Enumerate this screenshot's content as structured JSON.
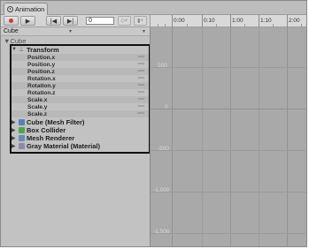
{
  "window": {
    "tab_title": "Animation"
  },
  "toolbar": {
    "frame_value": "0"
  },
  "ruler": {
    "labels": [
      "0:00",
      "0:10",
      "1:00",
      "1:10",
      "2:00"
    ]
  },
  "object_row": {
    "selected_object": "Cube"
  },
  "hierarchy": {
    "root": "Cube",
    "transform_label": "Transform",
    "properties": [
      "Position.x",
      "Position.y",
      "Position.z",
      "Rotation.x",
      "Rotation.y",
      "Rotation.z",
      "Scale.x",
      "Scale.y",
      "Scale.z"
    ],
    "components": [
      {
        "label": "Cube (Mesh Filter)",
        "icon": "mesh-filter-icon",
        "color": "#5a7fb8"
      },
      {
        "label": "Box Collider",
        "icon": "box-collider-icon",
        "color": "#4fa54f"
      },
      {
        "label": "Mesh Renderer",
        "icon": "mesh-renderer-icon",
        "color": "#6a8ab8"
      },
      {
        "label": "Gray Material (Material)",
        "icon": "material-icon",
        "color": "#8a8aa8"
      }
    ]
  },
  "curve_editor": {
    "y_labels": [
      "500",
      "0",
      "-500",
      "-1,000",
      "-1,500"
    ]
  },
  "colors": {
    "record_red": "#d23b2e",
    "highlight_border": "#111111"
  }
}
